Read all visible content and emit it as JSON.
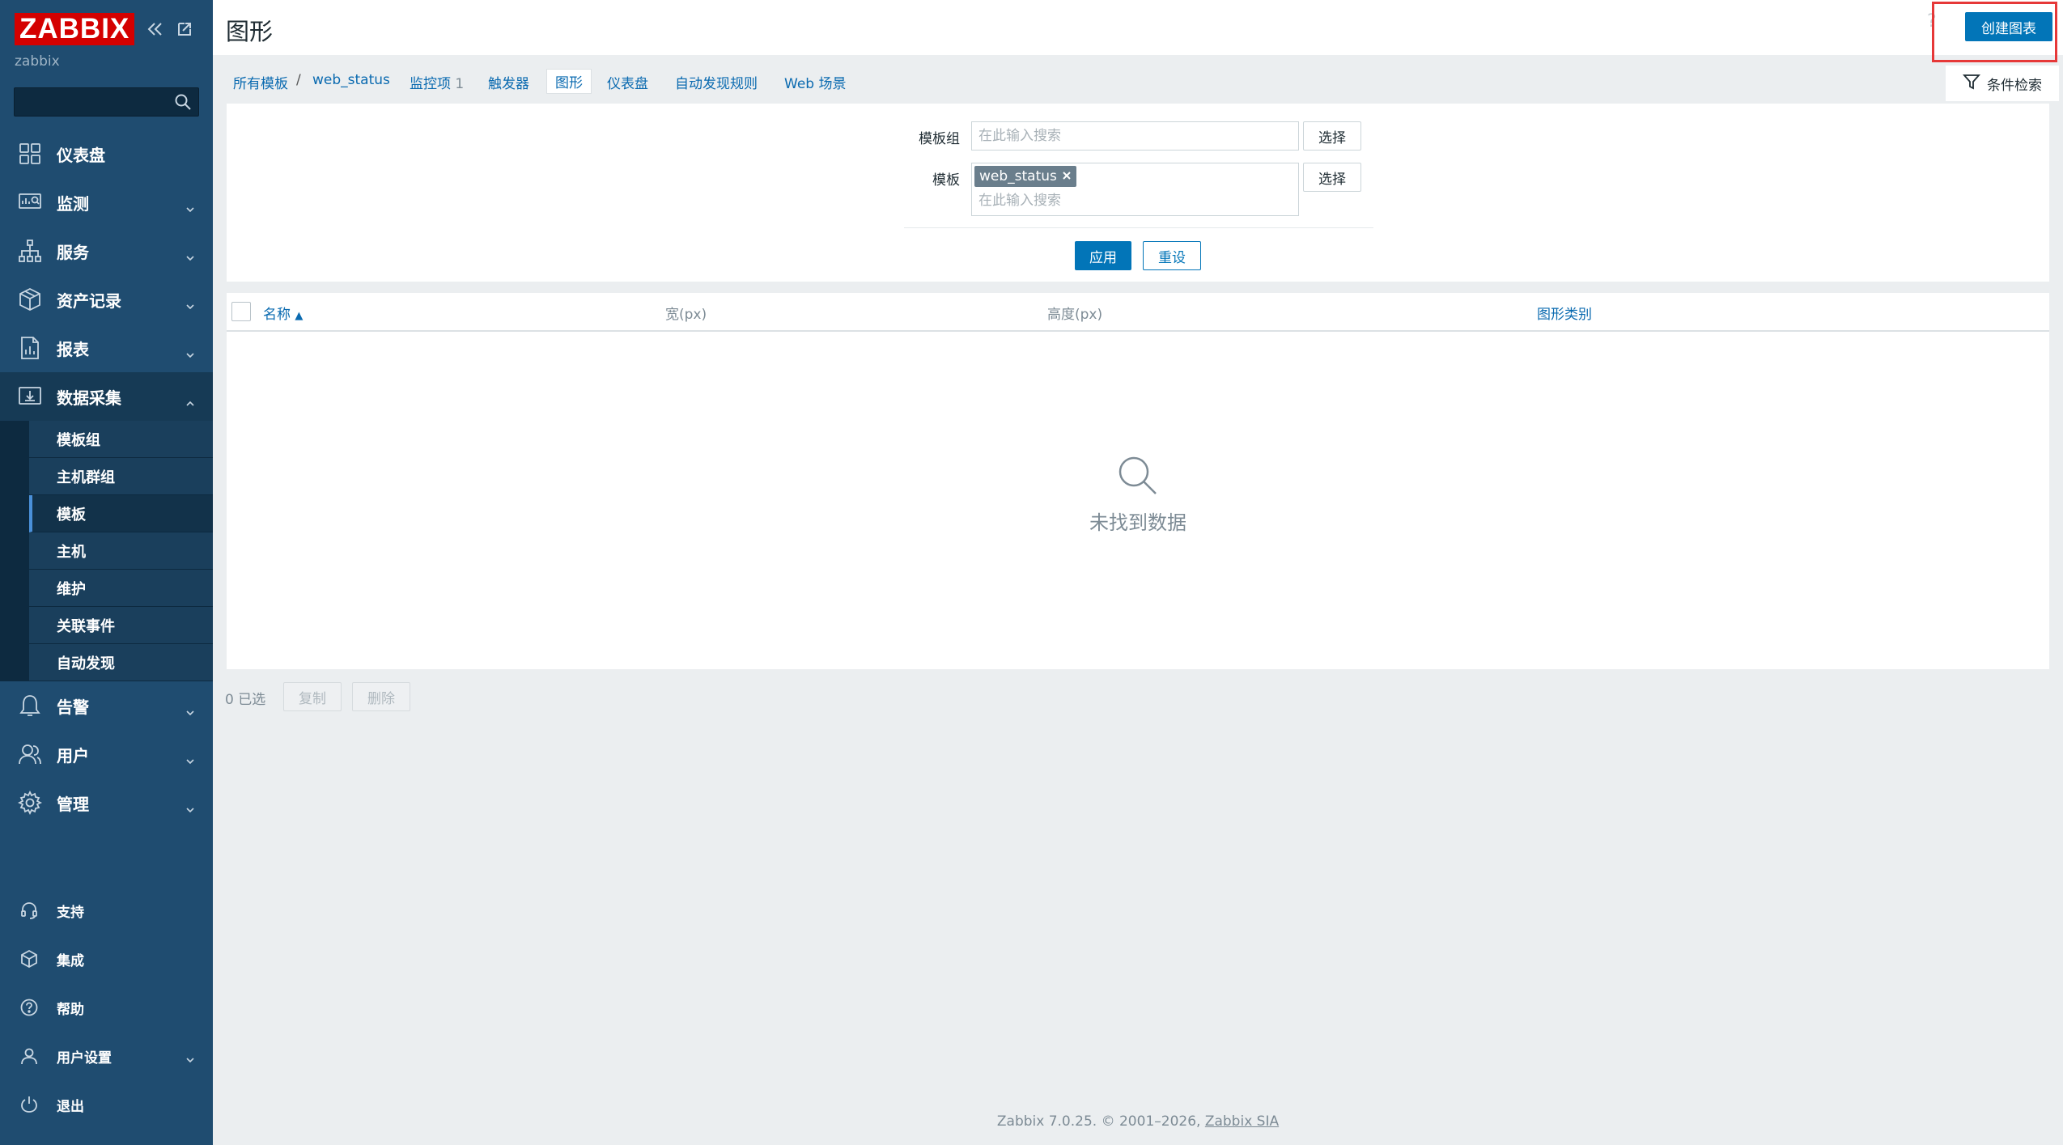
{
  "sidebar": {
    "logo": "ZABBIX",
    "server_name": "zabbix",
    "search_placeholder": "",
    "menu": [
      {
        "label": "仪表盘",
        "icon": "dashboard-icon"
      },
      {
        "label": "监测",
        "icon": "monitoring-icon"
      },
      {
        "label": "服务",
        "icon": "services-icon"
      },
      {
        "label": "资产记录",
        "icon": "inventory-icon"
      },
      {
        "label": "报表",
        "icon": "reports-icon"
      },
      {
        "label": "数据采集",
        "icon": "data-collection-icon"
      }
    ],
    "submenu": [
      {
        "label": "模板组"
      },
      {
        "label": "主机群组"
      },
      {
        "label": "模板"
      },
      {
        "label": "主机"
      },
      {
        "label": "维护"
      },
      {
        "label": "关联事件"
      },
      {
        "label": "自动发现"
      }
    ],
    "menu_after": [
      {
        "label": "告警",
        "icon": "alerts-icon"
      },
      {
        "label": "用户",
        "icon": "users-icon"
      },
      {
        "label": "管理",
        "icon": "administration-icon"
      }
    ],
    "bottom": [
      {
        "label": "支持",
        "icon": "support-icon"
      },
      {
        "label": "集成",
        "icon": "integrations-icon"
      },
      {
        "label": "帮助",
        "icon": "help-icon"
      },
      {
        "label": "用户设置",
        "icon": "user-settings-icon"
      },
      {
        "label": "退出",
        "icon": "signout-icon"
      }
    ]
  },
  "header": {
    "title": "图形",
    "help": "?",
    "create_button": "创建图表"
  },
  "tabs": {
    "all_templates": "所有模板",
    "separator": "/",
    "template": "web_status",
    "items": "监控项",
    "items_count": "1",
    "triggers": "触发器",
    "graphs": "图形",
    "dashboards": "仪表盘",
    "discovery": "自动发现规则",
    "web": "Web 场景",
    "filter": "条件检索"
  },
  "filter": {
    "template_group_label": "模板组",
    "template_group_placeholder": "在此输入搜索",
    "select_label": "选择",
    "template_label": "模板",
    "template_tag": "web_status",
    "template_placeholder": "在此输入搜索",
    "apply": "应用",
    "reset": "重设"
  },
  "table": {
    "columns": [
      "名称",
      "宽(px)",
      "高度(px)",
      "图形类别"
    ],
    "sort_indicator": "▲",
    "empty_text": "未找到数据"
  },
  "actions": {
    "selected": "0 已选",
    "copy": "复制",
    "delete": "删除"
  },
  "footer": {
    "text": "Zabbix 7.0.25. © 2001–2026, ",
    "company": "Zabbix SIA"
  }
}
